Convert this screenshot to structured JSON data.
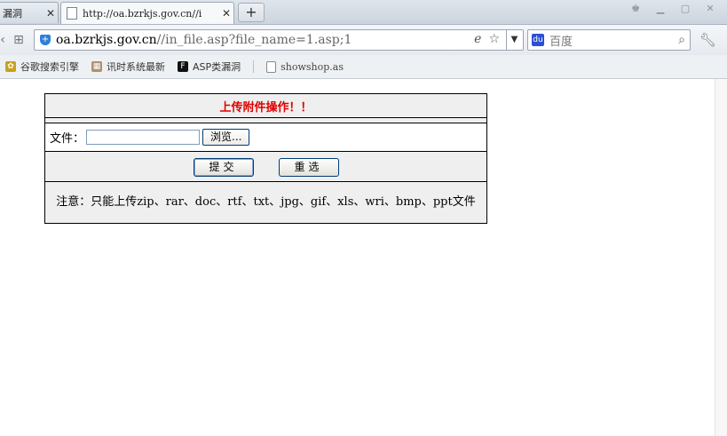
{
  "tabs": [
    {
      "label": "漏洞",
      "active": false
    },
    {
      "label": "http://oa.bzrkjs.gov.cn//i",
      "active": true
    }
  ],
  "new_tab_label": "+",
  "address": {
    "host": "oa.bzrkjs.gov.cn",
    "path": "//in_file.asp?file_name=1.asp;1"
  },
  "search": {
    "placeholder": "百度"
  },
  "bookmarks": [
    {
      "label": "谷歌搜索引擎",
      "icon": "google-icon"
    },
    {
      "label": "讯时系统最新",
      "icon": "xunshi-icon"
    },
    {
      "label": "ASP类漏洞",
      "icon": "asp-icon"
    },
    {
      "label": "showshop.as",
      "icon": "page-icon"
    }
  ],
  "form": {
    "title": "上传附件操作！！",
    "file_label": "文件：",
    "browse_label": "浏览...",
    "submit_label": "提交",
    "reset_label": "重选",
    "note": "注意：只能上传zip、rar、doc、rtf、txt、jpg、gif、xls、wri、bmp、ppt文件"
  },
  "colors": {
    "title_red": "#e00000",
    "cell_gray": "#efefef"
  }
}
